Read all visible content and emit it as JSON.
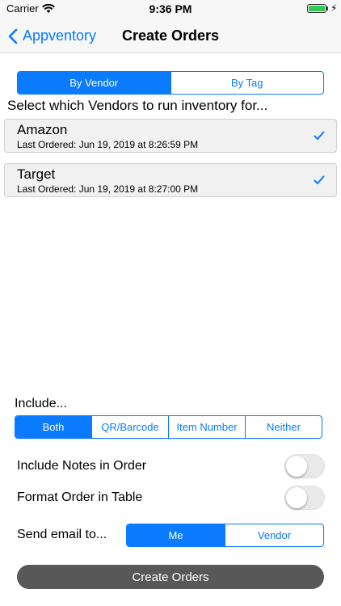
{
  "status_bar": {
    "carrier": "Carrier",
    "time": "9:36 PM"
  },
  "nav": {
    "back_label": "Appventory",
    "title": "Create Orders"
  },
  "mode_segment": {
    "options": [
      "By Vendor",
      "By Tag"
    ],
    "selected": "By Vendor"
  },
  "instruction": "Select which Vendors to run inventory for...",
  "vendors": [
    {
      "name": "Amazon",
      "last_ordered": "Last Ordered: Jun 19, 2019 at 8:26:59 PM",
      "checked": true
    },
    {
      "name": "Target",
      "last_ordered": "Last Ordered: Jun 19, 2019 at 8:27:00 PM",
      "checked": true
    }
  ],
  "include": {
    "label": "Include...",
    "options": [
      "Both",
      "QR/Barcode",
      "Item Number",
      "Neither"
    ],
    "selected": "Both"
  },
  "toggles": [
    {
      "label": "Include Notes in Order",
      "on": false
    },
    {
      "label": "Format Order in Table",
      "on": false
    }
  ],
  "send_email": {
    "label": "Send email to...",
    "options": [
      "Me",
      "Vendor"
    ],
    "selected": "Me"
  },
  "create_button": "Create Orders",
  "colors": {
    "accent": "#0a7aff",
    "button": "#585858",
    "check": "#0a7aff"
  }
}
